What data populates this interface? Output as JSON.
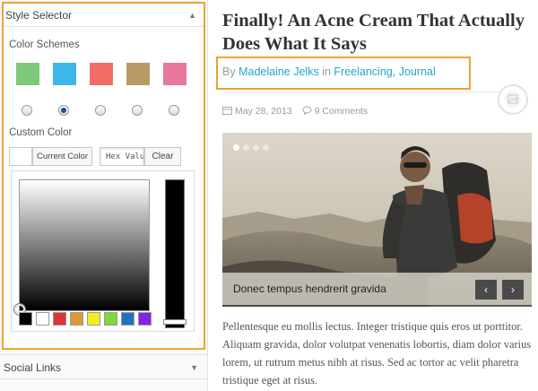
{
  "style_selector": {
    "title": "Style Selector",
    "collapse_icon": "triangle-up-icon",
    "color_schemes_label": "Color Schemes",
    "schemes": [
      {
        "color": "#7dc97a",
        "selected": false
      },
      {
        "color": "#3fb6e8",
        "selected": true
      },
      {
        "color": "#f26d66",
        "selected": false
      },
      {
        "color": "#b79b66",
        "selected": false
      },
      {
        "color": "#e8789e",
        "selected": false
      }
    ],
    "custom_color_label": "Custom Color",
    "current_color_button": "Current Color",
    "hex_placeholder": "Hex Value",
    "clear_button": "Clear",
    "palette": [
      "#000000",
      "#ffffff",
      "#dd3333",
      "#dd9933",
      "#eeee22",
      "#81d742",
      "#1e73be",
      "#8224e3"
    ]
  },
  "social_links": {
    "title": "Social Links",
    "expand_icon": "triangle-down-icon"
  },
  "post": {
    "title": "Finally! An Acne Cream That Actually Does What It Says",
    "by": "By",
    "author": "Madelaine Jelks",
    "in": "in",
    "category_1": "Freelancing",
    "separator": ",",
    "category_2": "Journal",
    "format_icon": "image-format-icon",
    "date": "May 28, 2013",
    "comments": "9 Comments",
    "slider_caption": "Donec tempus hendrerit gravida",
    "prev_label": "‹",
    "next_label": "›",
    "excerpt": "Pellentesque eu mollis lectus. Integer tristique quis eros ut porttitor. Aliquam gravida, dolor volutpat venenatis lobortis, diam dolor varius lorem, ut rutrum metus nibh at risus. Sed ac tortor ac velit pharetra tristique eget at risus."
  },
  "colors": {
    "accent": "#20a8c8",
    "highlight_border": "#f0a030"
  }
}
